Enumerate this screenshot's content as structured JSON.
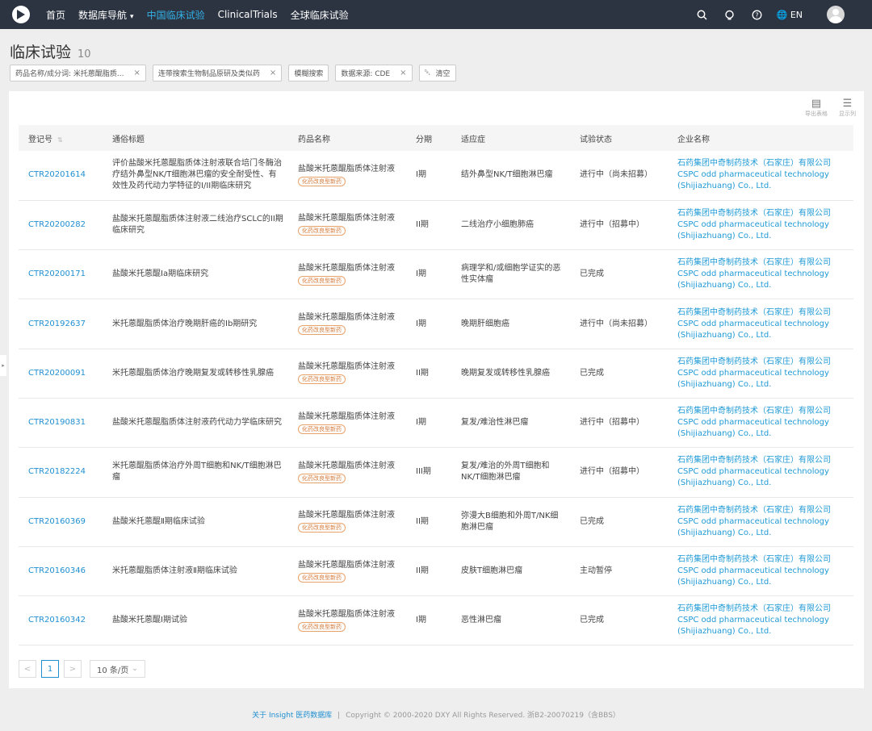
{
  "nav": {
    "items": [
      {
        "label": "首页",
        "active": false,
        "dropdown": false
      },
      {
        "label": "数据库导航",
        "active": false,
        "dropdown": true
      },
      {
        "label": "中国临床试验",
        "active": true,
        "dropdown": false
      },
      {
        "label": "ClinicalTrials",
        "active": false,
        "dropdown": false
      },
      {
        "label": "全球临床试验",
        "active": false,
        "dropdown": false
      }
    ],
    "lang": "EN"
  },
  "page": {
    "title": "临床试验",
    "count": "10"
  },
  "filters": [
    {
      "label": "药品名称/成分词: 米托蒽醌脂质...",
      "closable": true
    },
    {
      "label": "连带搜索生物制品原研及类似药",
      "closable": true
    },
    {
      "label": "模糊搜索",
      "closable": false
    },
    {
      "label": "数据来源: CDE",
      "closable": true
    }
  ],
  "clear_label": "清空",
  "tools": {
    "export_label": "导出表格",
    "columns_label": "显示列"
  },
  "table": {
    "headers": [
      "登记号",
      "通俗标题",
      "药品名称",
      "分期",
      "适应症",
      "试验状态",
      "企业名称"
    ],
    "rows": [
      {
        "reg": "CTR20201614",
        "title": "评价盐酸米托蒽醌脂质体注射液联合培门冬酶治疗结外鼻型NK/T细胞淋巴瘤的安全耐受性、有效性及药代动力学特征的I/II期临床研究",
        "drug": "盐酸米托蒽醌脂质体注射液",
        "tag": "化药改良型新药",
        "phase": "I期",
        "indication": "结外鼻型NK/T细胞淋巴瘤",
        "status": "进行中（尚未招募）",
        "company_cn": "石药集团中奇制药技术（石家庄）有限公司",
        "company_en": "CSPC odd pharmaceutical technology (Shijiazhuang) Co., Ltd."
      },
      {
        "reg": "CTR20200282",
        "title": "盐酸米托蒽醌脂质体注射液二线治疗SCLC的II期临床研究",
        "drug": "盐酸米托蒽醌脂质体注射液",
        "tag": "化药改良型新药",
        "phase": "II期",
        "indication": "二线治疗小细胞肺癌",
        "status": "进行中（招募中）",
        "company_cn": "石药集团中奇制药技术（石家庄）有限公司",
        "company_en": "CSPC odd pharmaceutical technology (Shijiazhuang) Co., Ltd."
      },
      {
        "reg": "CTR20200171",
        "title": "盐酸米托蒽醌Ia期临床研究",
        "drug": "盐酸米托蒽醌脂质体注射液",
        "tag": "化药改良型新药",
        "phase": "I期",
        "indication": "病理学和/或细胞学证实的恶性实体瘤",
        "status": "已完成",
        "company_cn": "石药集团中奇制药技术（石家庄）有限公司",
        "company_en": "CSPC odd pharmaceutical technology (Shijiazhuang) Co., Ltd."
      },
      {
        "reg": "CTR20192637",
        "title": "米托蒽醌脂质体治疗晚期肝癌的Ⅰb期研究",
        "drug": "盐酸米托蒽醌脂质体注射液",
        "tag": "化药改良型新药",
        "phase": "I期",
        "indication": "晚期肝细胞癌",
        "status": "进行中（尚未招募）",
        "company_cn": "石药集团中奇制药技术（石家庄）有限公司",
        "company_en": "CSPC odd pharmaceutical technology (Shijiazhuang) Co., Ltd."
      },
      {
        "reg": "CTR20200091",
        "title": "米托蒽醌脂质体治疗晚期复发或转移性乳腺癌",
        "drug": "盐酸米托蒽醌脂质体注射液",
        "tag": "化药改良型新药",
        "phase": "II期",
        "indication": "晚期复发或转移性乳腺癌",
        "status": "已完成",
        "company_cn": "石药集团中奇制药技术（石家庄）有限公司",
        "company_en": "CSPC odd pharmaceutical technology (Shijiazhuang) Co., Ltd."
      },
      {
        "reg": "CTR20190831",
        "title": "盐酸米托蒽醌脂质体注射液药代动力学临床研究",
        "drug": "盐酸米托蒽醌脂质体注射液",
        "tag": "化药改良型新药",
        "phase": "I期",
        "indication": "复发/难治性淋巴瘤",
        "status": "进行中（招募中）",
        "company_cn": "石药集团中奇制药技术（石家庄）有限公司",
        "company_en": "CSPC odd pharmaceutical technology (Shijiazhuang) Co., Ltd."
      },
      {
        "reg": "CTR20182224",
        "title": "米托蒽醌脂质体治疗外周T细胞和NK/T细胞淋巴瘤",
        "drug": "盐酸米托蒽醌脂质体注射液",
        "tag": "化药改良型新药",
        "phase": "III期",
        "indication": "复发/难治的外周T细胞和NK/T细胞淋巴瘤",
        "status": "进行中（招募中）",
        "company_cn": "石药集团中奇制药技术（石家庄）有限公司",
        "company_en": "CSPC odd pharmaceutical technology (Shijiazhuang) Co., Ltd."
      },
      {
        "reg": "CTR20160369",
        "title": "盐酸米托蒽醌Ⅱ期临床试验",
        "drug": "盐酸米托蒽醌脂质体注射液",
        "tag": "化药改良型新药",
        "phase": "II期",
        "indication": "弥漫大B细胞和外周T/NK细胞淋巴瘤",
        "status": "已完成",
        "company_cn": "石药集团中奇制药技术（石家庄）有限公司",
        "company_en": "CSPC odd pharmaceutical technology (Shijiazhuang) Co., Ltd."
      },
      {
        "reg": "CTR20160346",
        "title": "米托蒽醌脂质体注射液Ⅱ期临床试验",
        "drug": "盐酸米托蒽醌脂质体注射液",
        "tag": "化药改良型新药",
        "phase": "II期",
        "indication": "皮肤T细胞淋巴瘤",
        "status": "主动暂停",
        "company_cn": "石药集团中奇制药技术（石家庄）有限公司",
        "company_en": "CSPC odd pharmaceutical technology (Shijiazhuang) Co., Ltd."
      },
      {
        "reg": "CTR20160342",
        "title": "盐酸米托蒽醌Ⅰ期试验",
        "drug": "盐酸米托蒽醌脂质体注射液",
        "tag": "化药改良型新药",
        "phase": "I期",
        "indication": "恶性淋巴瘤",
        "status": "已完成",
        "company_cn": "石药集团中奇制药技术（石家庄）有限公司",
        "company_en": "CSPC odd pharmaceutical technology (Shijiazhuang) Co., Ltd."
      }
    ]
  },
  "pagination": {
    "prev": "<",
    "current": "1",
    "next": ">",
    "page_size": "10 条/页"
  },
  "footer": {
    "link": "关于 Insight 医药数据库",
    "separator": "|",
    "copyright": "Copyright © 2000-2020 DXY All Rights Reserved. 浙B2-20070219（含BBS）"
  }
}
